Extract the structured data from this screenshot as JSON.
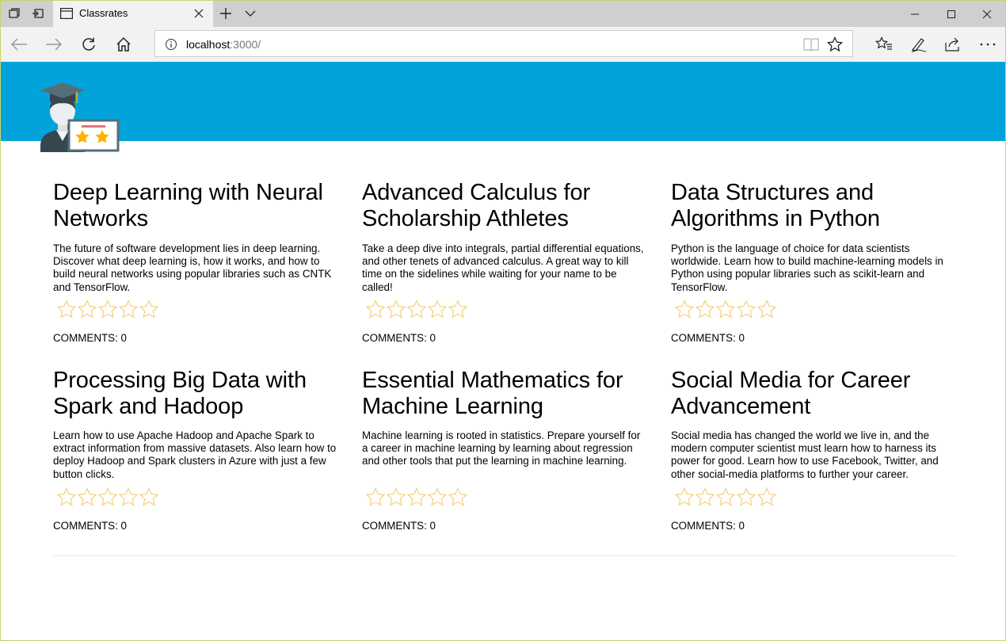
{
  "browser": {
    "tab_title": "Classrates",
    "url_host": "localhost",
    "url_rest": ":3000/",
    "accent": "#02a3da"
  },
  "courses": [
    {
      "title": "Deep Learning with Neural Networks",
      "description": "The future of software development lies in deep learning. Discover what deep learning is, how it works, and how to build neural networks using popular libraries such as CNTK and TensorFlow.",
      "rating": 0,
      "comments_label": "COMMENTS: 0"
    },
    {
      "title": "Advanced Calculus for Scholarship Athletes",
      "description": "Take a deep dive into integrals, partial differential equations, and other tenets of advanced calculus. A great way to kill time on the sidelines while waiting for your name to be called!",
      "rating": 0,
      "comments_label": "COMMENTS: 0"
    },
    {
      "title": "Data Structures and Algorithms in Python",
      "description": "Python is the language of choice for data scientists worldwide. Learn how to build machine-learning models in Python using popular libraries such as scikit-learn and TensorFlow.",
      "rating": 0,
      "comments_label": "COMMENTS: 0"
    },
    {
      "title": "Processing Big Data with Spark and Hadoop",
      "description": "Learn how to use Apache Hadoop and Apache Spark to extract information from massive datasets. Also learn how to deploy Hadoop and Spark clusters in Azure with just a few button clicks.",
      "rating": 0,
      "comments_label": "COMMENTS: 0"
    },
    {
      "title": "Essential Mathematics for Machine Learning",
      "description": "Machine learning is rooted in statistics. Prepare yourself for a career in machine learning by learning about regression and other tools that put the learning in machine learning.",
      "rating": 0,
      "comments_label": "COMMENTS: 0"
    },
    {
      "title": "Social Media for Career Advancement",
      "description": "Social media has changed the world we live in, and the modern computer scientist must learn how to harness its power for good. Learn how to use Facebook, Twitter, and other social-media platforms to further your career.",
      "rating": 0,
      "comments_label": "COMMENTS: 0"
    }
  ]
}
